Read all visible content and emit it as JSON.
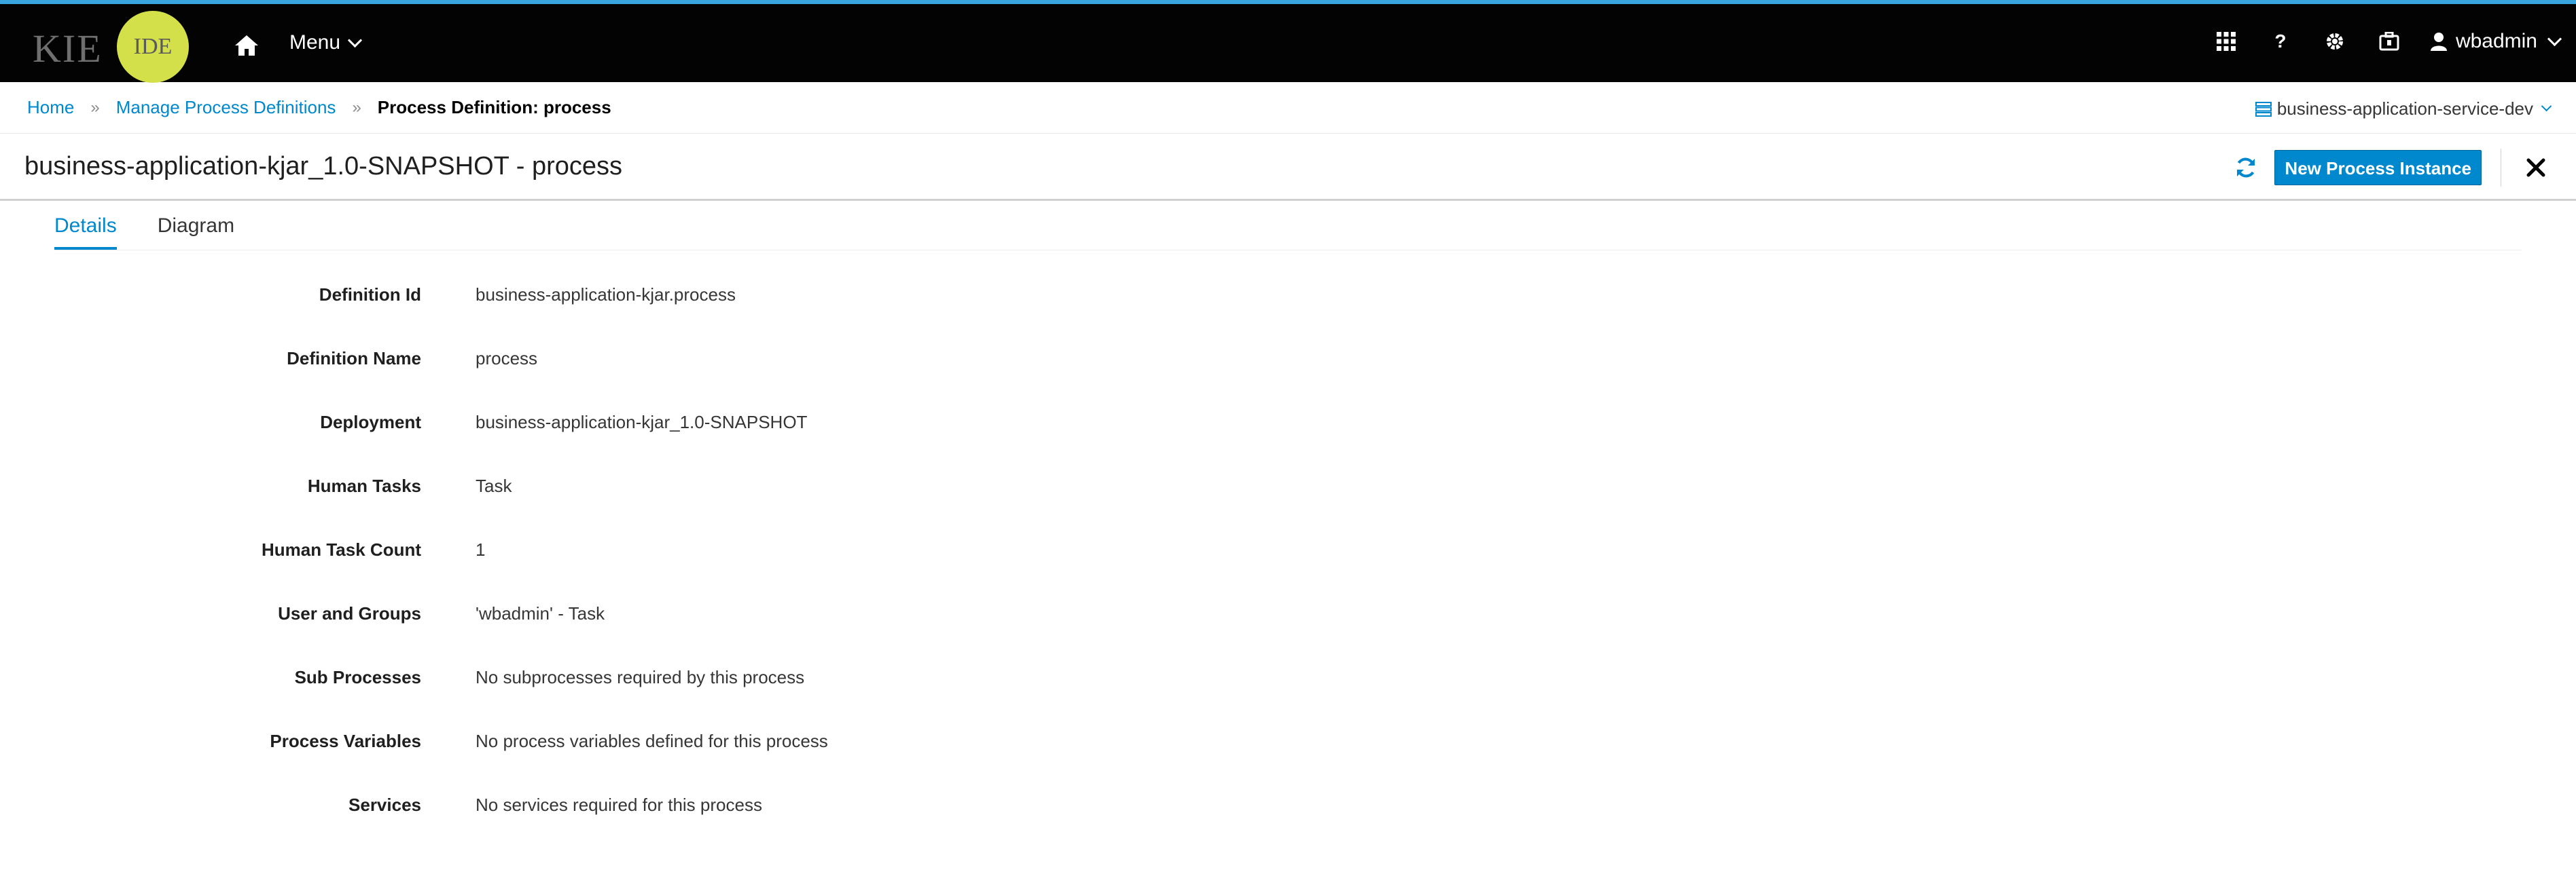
{
  "branding": {
    "kie": "KIE",
    "ide": "IDE",
    "circle_color": "#d4e04a"
  },
  "topbar": {
    "menu_label": "Menu",
    "username": "wbadmin",
    "help_glyph": "?"
  },
  "breadcrumb": {
    "home": "Home",
    "manage": "Manage Process Definitions",
    "current": "Process Definition: process",
    "separator": "»"
  },
  "server": {
    "name": "business-application-service-dev"
  },
  "header": {
    "title": "business-application-kjar_1.0-SNAPSHOT - process",
    "new_instance_label": "New Process Instance"
  },
  "tabs": [
    "Details",
    "Diagram"
  ],
  "details": [
    {
      "label": "Definition Id",
      "value": "business-application-kjar.process"
    },
    {
      "label": "Definition Name",
      "value": "process"
    },
    {
      "label": "Deployment",
      "value": "business-application-kjar_1.0-SNAPSHOT"
    },
    {
      "label": "Human Tasks",
      "value": "Task"
    },
    {
      "label": "Human Task Count",
      "value": "1"
    },
    {
      "label": "User and Groups",
      "value": "'wbadmin' - Task"
    },
    {
      "label": "Sub Processes",
      "value": "No subprocesses required by this process"
    },
    {
      "label": "Process Variables",
      "value": "No process variables defined for this process"
    },
    {
      "label": "Services",
      "value": "No services required for this process"
    }
  ],
  "colors": {
    "accent": "#0088ce",
    "topbar": "#030303",
    "accent_bar": "#39a5dc"
  }
}
